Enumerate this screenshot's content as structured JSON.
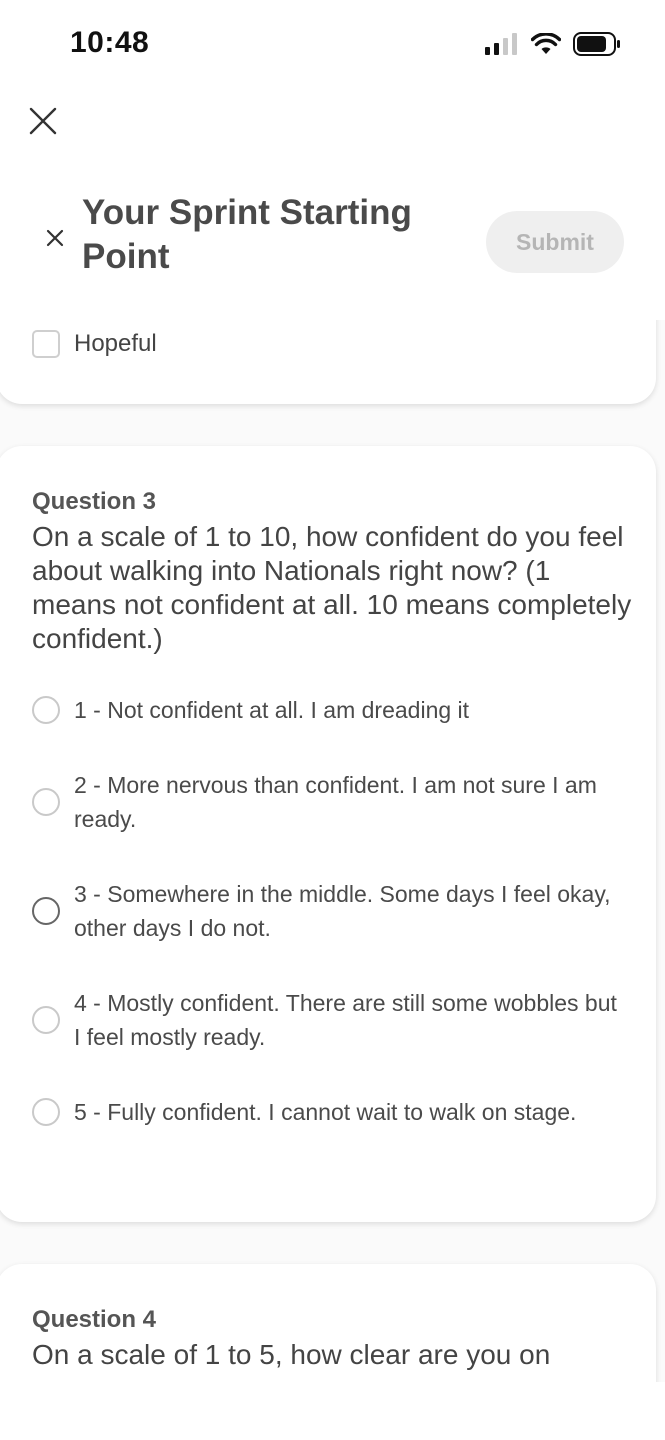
{
  "status_bar": {
    "time": "10:48"
  },
  "header": {
    "title": "Your Sprint Starting Point",
    "submit_label": "Submit"
  },
  "question2_tail": {
    "option": "Hopeful"
  },
  "question3": {
    "number": "Question 3",
    "text": "On a scale of 1 to 10, how confident do you feel about walking into Nationals right now? (1 means not confident at all. 10 means completely confident.)",
    "options": [
      "1 - Not confident at all. I am dreading it",
      "2 - More nervous than confident. I am not sure I am ready.",
      "3 - Somewhere in the middle. Some days I feel okay, other days I do not.",
      "4 - Mostly confident. There are still some wobbles but I feel mostly ready.",
      "5 - Fully confident. I cannot wait to walk on stage."
    ]
  },
  "question4": {
    "number": "Question 4",
    "text": "On a scale of 1 to 5, how clear are you on"
  },
  "colors": {
    "submit_bg": "#efefef",
    "submit_text": "#b5b5b5",
    "text": "#444444"
  }
}
